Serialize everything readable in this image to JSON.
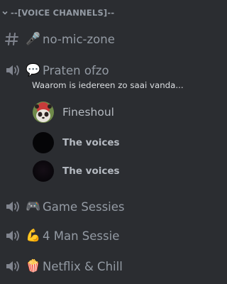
{
  "category": {
    "label": "--[VOICE CHANNELS]--",
    "chevron_icon": "chevron-down-icon"
  },
  "channels": [
    {
      "type": "text",
      "icon": "hash-icon",
      "emoji": "🎤",
      "name": "no-mic-zone"
    },
    {
      "type": "voice",
      "icon": "speaker-icon",
      "emoji": "💬",
      "name": "Praten ofzo",
      "status": "Waarom is iedereen zo saai vanda..."
    },
    {
      "type": "voice",
      "icon": "speaker-icon",
      "emoji": "🎮",
      "name": "Game Sessies"
    },
    {
      "type": "voice",
      "icon": "speaker-icon",
      "emoji": "💪",
      "name": "4 Man Sessie"
    },
    {
      "type": "voice",
      "icon": "speaker-icon",
      "emoji": "🍿",
      "name": "Netflix & Chill"
    }
  ],
  "voice_users": [
    {
      "name": "Fineshoul",
      "avatar": "panda-avatar"
    },
    {
      "name": "The voices",
      "avatar": "black-avatar"
    },
    {
      "name": "The voices",
      "avatar": "dark-avatar"
    }
  ],
  "colors": {
    "background": "#2b2d31",
    "muted_text": "#949ba4",
    "status_text": "#dbdee1",
    "user_text": "#b5bac1"
  }
}
